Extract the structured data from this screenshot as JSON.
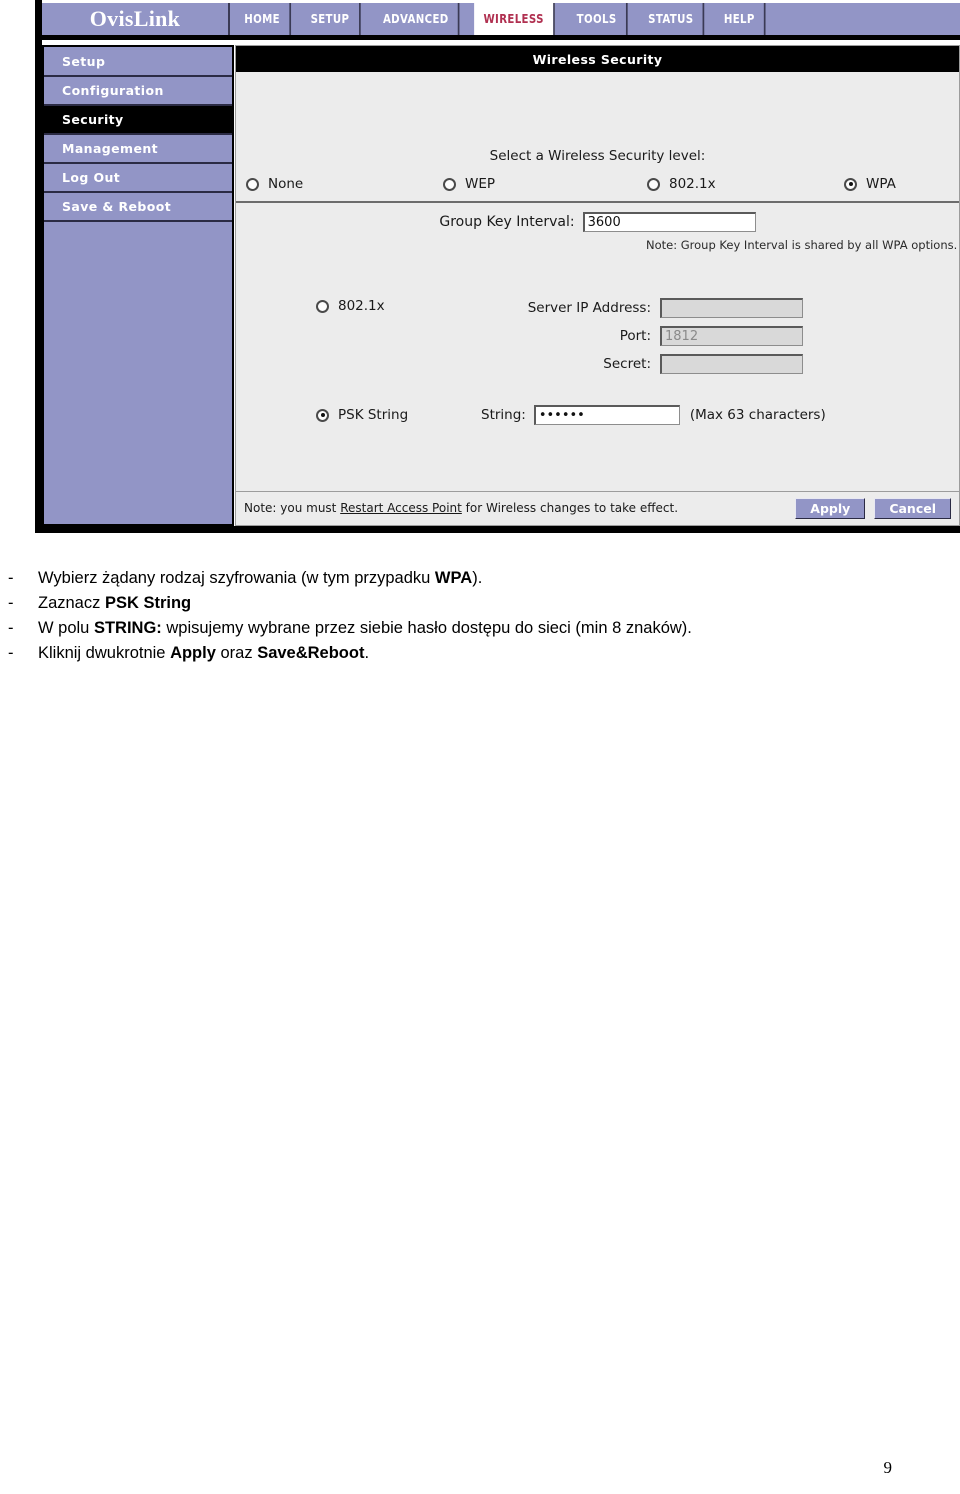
{
  "router_ui": {
    "brand": "OvisLink",
    "nav": [
      {
        "label": "HOME",
        "active": false
      },
      {
        "label": "SETUP",
        "active": false
      },
      {
        "label": "ADVANCED",
        "active": false
      },
      {
        "label": "WIRELESS",
        "active": true
      },
      {
        "label": "TOOLS",
        "active": false
      },
      {
        "label": "STATUS",
        "active": false
      },
      {
        "label": "HELP",
        "active": false
      }
    ],
    "sidebar": {
      "items": [
        {
          "label": "Setup",
          "active": false
        },
        {
          "label": "Configuration",
          "active": false
        },
        {
          "label": "Security",
          "active": true
        },
        {
          "label": "Management",
          "active": false
        },
        {
          "label": "Log Out",
          "active": false
        },
        {
          "label": "Save & Reboot",
          "active": false
        }
      ]
    },
    "content": {
      "title": "Wireless Security",
      "security_level_label": "Select a Wireless Security level:",
      "levels": [
        {
          "label": "None",
          "selected": false
        },
        {
          "label": "WEP",
          "selected": false
        },
        {
          "label": "802.1x",
          "selected": false
        },
        {
          "label": "WPA",
          "selected": true
        }
      ],
      "group_key": {
        "label": "Group Key Interval:",
        "value": "3600",
        "note": "Note: Group Key Interval is shared by all WPA options."
      },
      "dot1x": {
        "radio_label": "802.1x",
        "selected": false,
        "fields": [
          {
            "label": "Server IP Address:",
            "value": "",
            "disabled": true
          },
          {
            "label": "Port:",
            "value": "1812",
            "disabled": true
          },
          {
            "label": "Secret:",
            "value": "",
            "disabled": true
          }
        ]
      },
      "psk": {
        "radio_label": "PSK String",
        "selected": true,
        "field_label": "String:",
        "value": "******",
        "hint": "(Max 63 characters)"
      },
      "footer": {
        "note_before": "Note: you must ",
        "note_link": "Restart Access Point",
        "note_after": " for Wireless changes to take effect.",
        "apply_label": "Apply",
        "cancel_label": "Cancel"
      }
    },
    "colors": {
      "purple": "#9295c6",
      "active_tab_text": "#b03050",
      "panel_bg": "#ececec",
      "title_bg": "#000000"
    }
  },
  "caption": {
    "dash": "-",
    "lines": [
      {
        "pre": "Wybierz żądany rodzaj szyfrowania (w tym przypadku ",
        "bold": "WPA",
        "post": ")."
      },
      {
        "pre": "Zaznacz ",
        "bold": "PSK String",
        "post": ""
      },
      {
        "pre": "W polu ",
        "bold": "STRING:",
        "post": " wpisujemy wybrane przez siebie hasło dostępu do sieci (min 8 znaków)."
      },
      {
        "pre": "Kliknij dwukrotnie ",
        "bold": "Apply",
        "post": " oraz ",
        "bold2": "Save&Reboot",
        "post2": "."
      }
    ]
  },
  "page_number": "9"
}
